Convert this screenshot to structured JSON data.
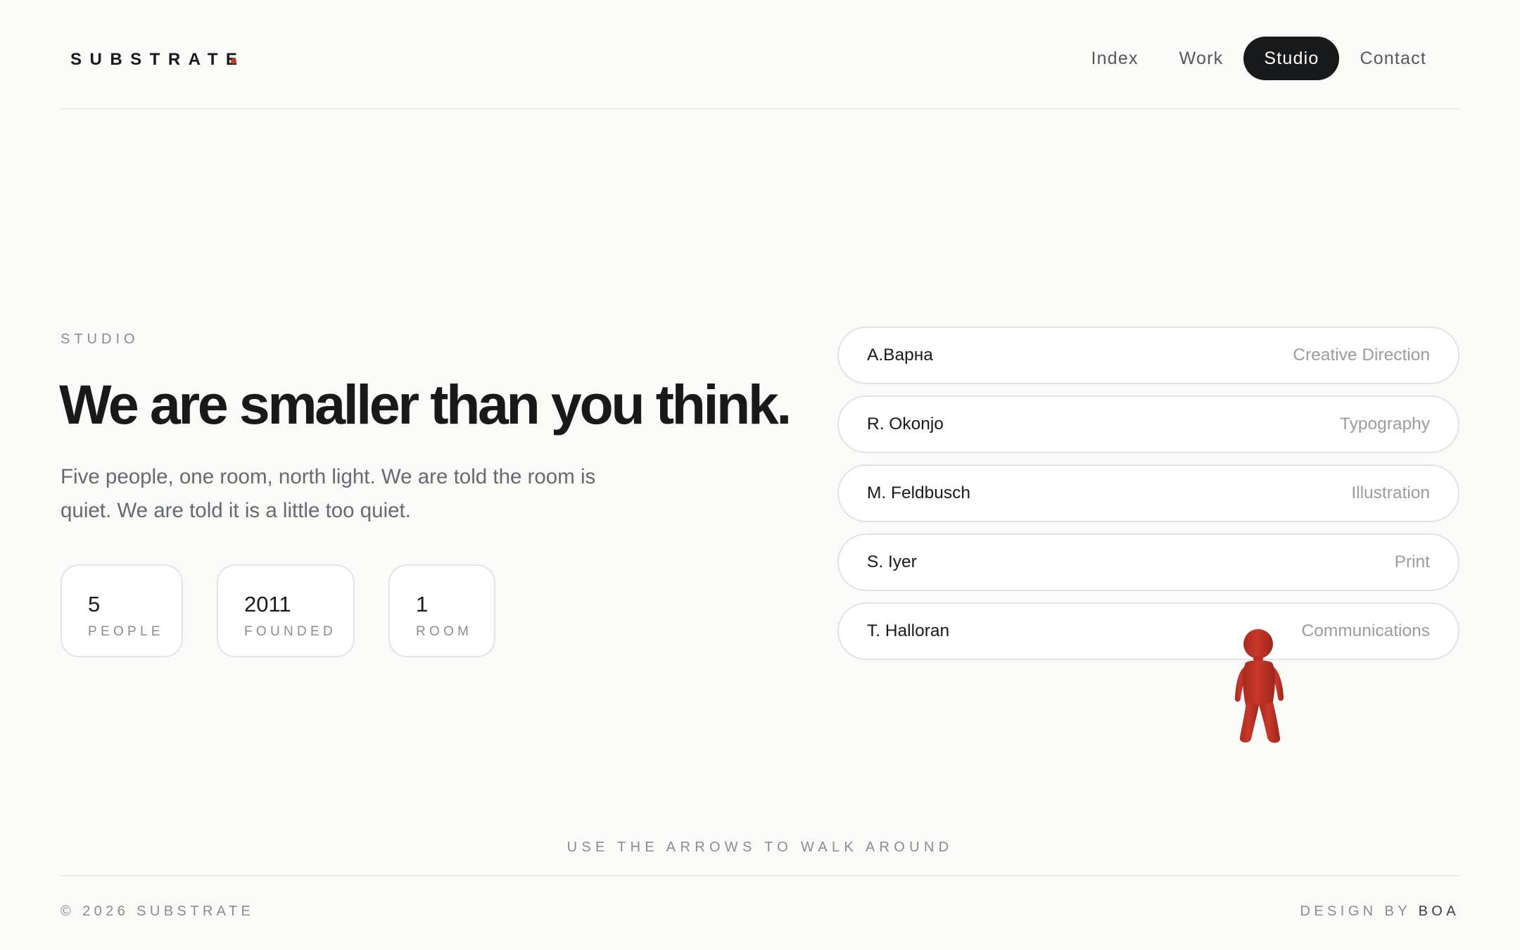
{
  "brand": {
    "name": "SUBSTRATE",
    "dot_color": "#c23a2b"
  },
  "nav": {
    "items": [
      {
        "label": "Index",
        "active": false
      },
      {
        "label": "Work",
        "active": false
      },
      {
        "label": "Studio",
        "active": true
      },
      {
        "label": "Contact",
        "active": false
      }
    ]
  },
  "hero": {
    "eyebrow": "STUDIO",
    "headline": "We are smaller than you think.",
    "lede": "Five people, one room, north light. We are told the room is quiet. We are told it is a little too quiet."
  },
  "stats": [
    {
      "value": "5",
      "label": "PEOPLE"
    },
    {
      "value": "2011",
      "label": "FOUNDED"
    },
    {
      "value": "1",
      "label": "ROOM"
    }
  ],
  "team": [
    {
      "name": "A.Варна",
      "role": "Creative Direction"
    },
    {
      "name": "R. Okonjo",
      "role": "Typography"
    },
    {
      "name": "M. Feldbusch",
      "role": "Illustration"
    },
    {
      "name": "S. Iyer",
      "role": "Print"
    },
    {
      "name": "T. Halloran",
      "role": "Communications"
    }
  ],
  "figure": {
    "icon": "walking-figure-icon",
    "color": "#c23a2b"
  },
  "footer": {
    "hint": "USE THE ARROWS TO WALK AROUND",
    "copyright": "© 2026 SUBSTRATE",
    "credit_prefix": "DESIGN BY",
    "credit_name": "BOA"
  },
  "colors": {
    "background": "#fafaf9",
    "ink": "#18191b",
    "muted": "#8a8c90",
    "accent": "#c23a2b"
  }
}
